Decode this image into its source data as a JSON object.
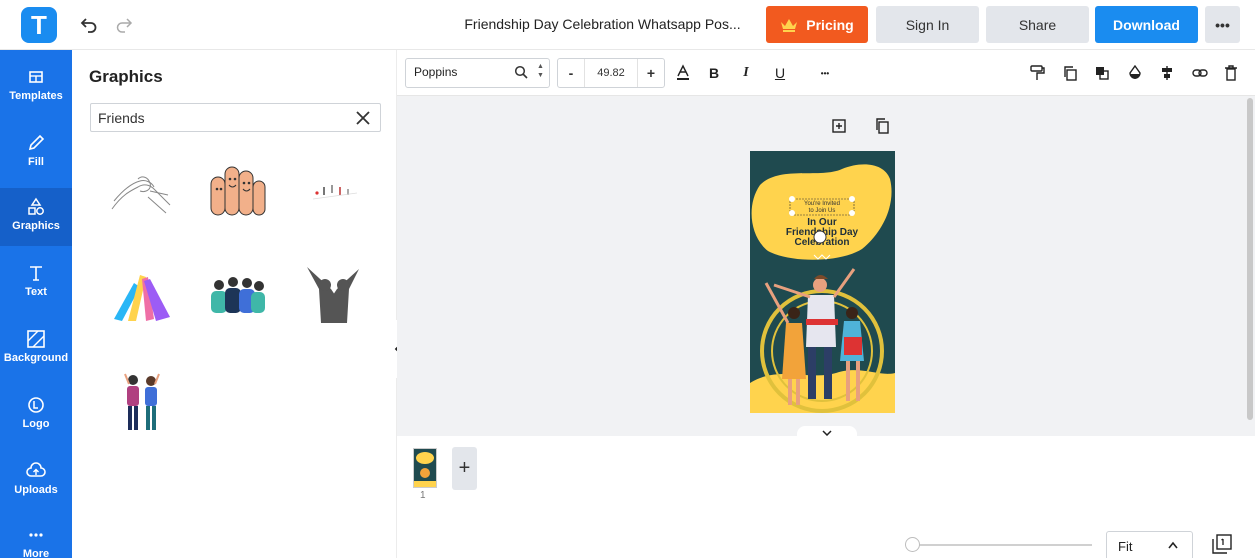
{
  "topbar": {
    "logo_letter": "T",
    "title": "Friendship Day Celebration Whatsapp Pos...",
    "pricing": "Pricing",
    "sign_in": "Sign In",
    "share": "Share",
    "download": "Download",
    "more": "•••"
  },
  "rail": [
    {
      "label": "Templates",
      "icon": "templates-icon"
    },
    {
      "label": "Fill",
      "icon": "pencil-icon"
    },
    {
      "label": "Graphics",
      "icon": "shapes-icon",
      "active": true
    },
    {
      "label": "Text",
      "icon": "text-icon"
    },
    {
      "label": "Background",
      "icon": "background-icon"
    },
    {
      "label": "Logo",
      "icon": "logo-icon"
    },
    {
      "label": "Uploads",
      "icon": "upload-cloud-icon"
    },
    {
      "label": "More",
      "icon": "more-dots-icon"
    }
  ],
  "panel": {
    "title": "Graphics",
    "search_value": "Friends"
  },
  "toolbar": {
    "font": "Poppins",
    "size": "49.82",
    "minus": "-",
    "plus": "+",
    "bold": "B",
    "italic": "I",
    "underline": "U",
    "more": "•••"
  },
  "artboard": {
    "invite_line1": "You're Invited",
    "invite_line2": "to Join Us",
    "heading1": "In Our",
    "heading2": "Friendship Day",
    "heading3": "Celebration"
  },
  "pages": {
    "page_number": "1",
    "add": "+"
  },
  "zoom": {
    "fit": "Fit"
  },
  "colors": {
    "brand_blue": "#1a73e8",
    "download_blue": "#1a8cf0",
    "pricing_orange": "#f25a1f",
    "artboard_teal": "#1f4a4f",
    "artboard_yellow": "#ffd34d"
  }
}
